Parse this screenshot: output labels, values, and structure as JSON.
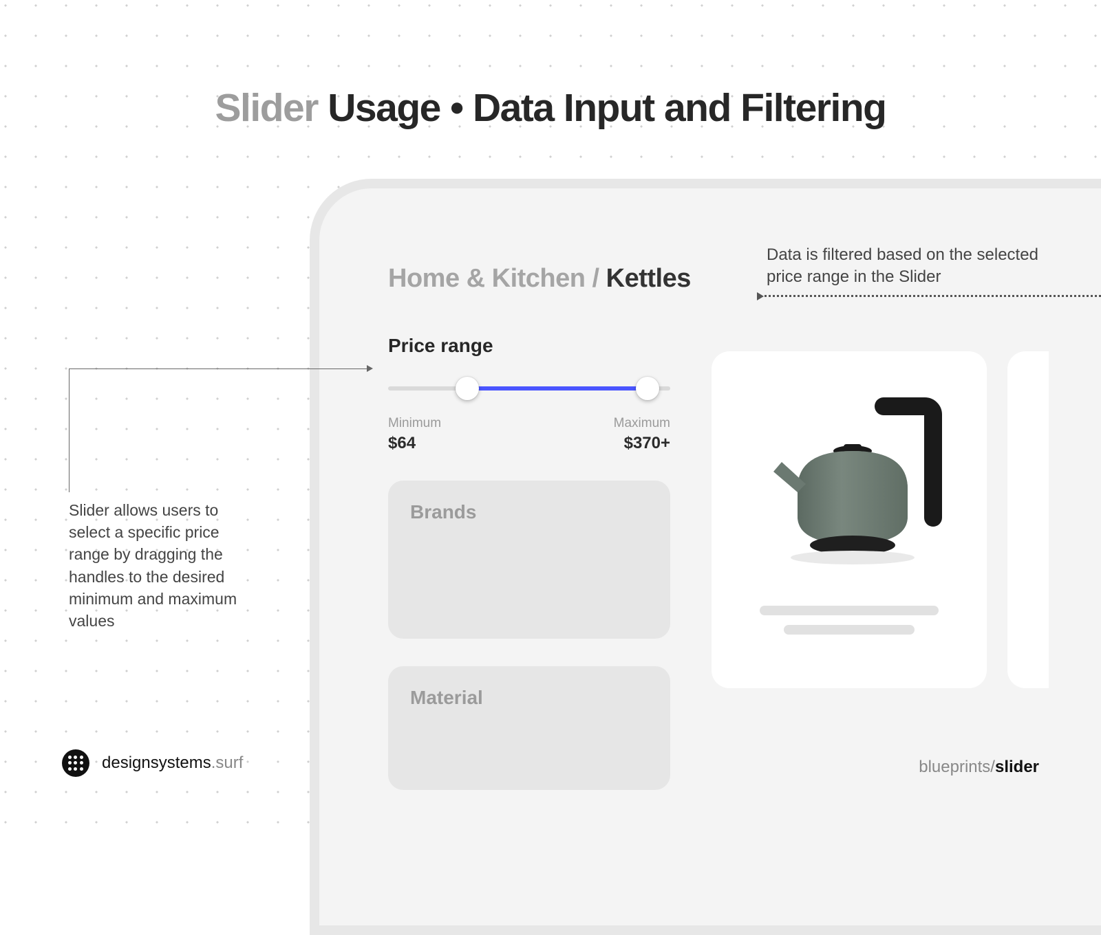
{
  "title": {
    "muted": "Slider",
    "rest": " Usage • Data Input and Filtering"
  },
  "breadcrumb": {
    "parent": "Home & Kitchen",
    "sep": " / ",
    "current": "Kettles"
  },
  "filters": {
    "price": {
      "title": "Price range",
      "min_label": "Minimum",
      "min_value": "$64",
      "max_label": "Maximum",
      "max_value": "$370+",
      "slider_percent_min": 28,
      "slider_percent_max": 92
    },
    "brands_title": "Brands",
    "material_title": "Material"
  },
  "annotations": {
    "left": "Slider allows users to select a specific price range by dragging the handles to the desired minimum and maximum values",
    "right": "Data is filtered based on the selected price range in the Slider"
  },
  "footer": {
    "brand_main": "designsystems",
    "brand_suffix": ".surf",
    "path_prefix": "blueprints/",
    "path_name": "slider"
  },
  "colors": {
    "accent": "#4a55ff"
  }
}
